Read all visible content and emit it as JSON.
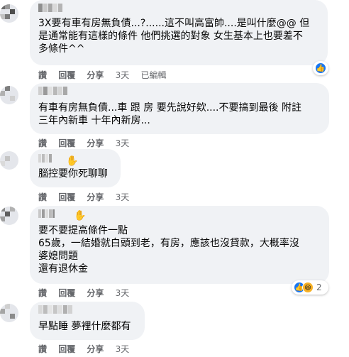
{
  "colors": {
    "bubble_bg": "#f0f2f5",
    "meta_text": "#65676b",
    "like_blue": "#1877f2",
    "haha_yellow": "#f7b125"
  },
  "actions": {
    "like": "讚",
    "reply": "回覆",
    "share": "分享"
  },
  "comments": [
    {
      "name": "3X",
      "lines": [
        "3X要有車有房無負債...?......這不叫高富帥....是叫什麼@@ 但",
        "是通常能有這樣的條件 他們挑選的對象 女生基本上也要差不",
        "多條件^^"
      ],
      "time": "3天",
      "edited": "已編輯",
      "reaction_icons": [
        "like-icon"
      ]
    },
    {
      "lines": [
        "有車有房無負債...車 跟 房 要先說好欸....不要搞到最後 附註",
        "三年內新車 十年內新房..."
      ],
      "time": "3天"
    },
    {
      "lines": [
        "腦控要你死聊聊"
      ],
      "time": "3天",
      "badge_icon": "waving-hand-icon"
    },
    {
      "lines": [
        "要不要提高條件一點",
        "65歲，一結婚就白頭到老，有房，應該也沒貸款，大概率沒",
        "婆媳問題",
        "還有退休金"
      ],
      "time": "3天",
      "badge_icon": "waving-hand-icon",
      "reaction_icons": [
        "like-icon",
        "haha-icon"
      ],
      "reaction_count": "2"
    },
    {
      "lines": [
        "早點睡 夢裡什麼都有"
      ],
      "time": "3天"
    }
  ]
}
